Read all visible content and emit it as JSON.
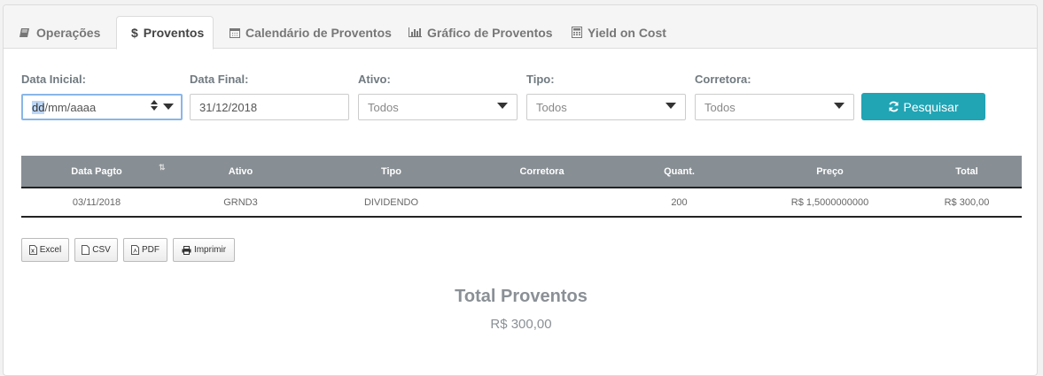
{
  "tabs": [
    {
      "label": "Operações",
      "icon": "book-icon"
    },
    {
      "label": "Proventos",
      "icon": "dollar-icon"
    },
    {
      "label": "Calendário de Proventos",
      "icon": "calendar-icon"
    },
    {
      "label": "Gráfico de Proventos",
      "icon": "bar-chart-icon"
    },
    {
      "label": "Yield on Cost",
      "icon": "calculator-icon"
    }
  ],
  "filters": {
    "data_inicial_label": "Data Inicial:",
    "data_inicial_value_dd": "dd",
    "data_inicial_value_rest": "/mm/aaaa",
    "data_final_label": "Data Final:",
    "data_final_value": "31/12/2018",
    "ativo_label": "Ativo:",
    "ativo_value": "Todos",
    "tipo_label": "Tipo:",
    "tipo_value": "Todos",
    "corretora_label": "Corretora:",
    "corretora_value": "Todos",
    "search_label": "Pesquisar"
  },
  "table": {
    "headers": [
      "Data Pagto",
      "Ativo",
      "Tipo",
      "Corretora",
      "Quant.",
      "Preço",
      "Total"
    ],
    "rows": [
      [
        "03/11/2018",
        "GRND3",
        "DIVIDENDO",
        "",
        "200",
        "R$ 1,5000000000",
        "R$ 300,00"
      ]
    ]
  },
  "export_buttons": {
    "excel": "Excel",
    "csv": "CSV",
    "pdf": "PDF",
    "print": "Imprimir"
  },
  "summary": {
    "title": "Total Proventos",
    "value": "R$ 300,00"
  },
  "colors": {
    "accent": "#21a4b4",
    "table_header": "#878e94"
  }
}
